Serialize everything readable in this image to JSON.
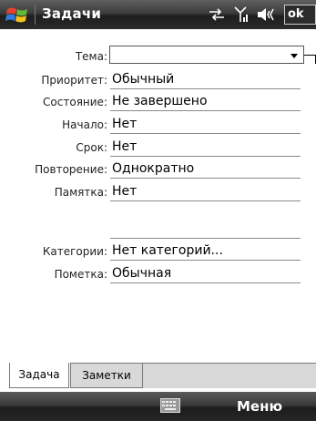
{
  "titlebar": {
    "title": "Задачи",
    "ok_label": "ok"
  },
  "form": {
    "subject_label": "Тема:",
    "subject_value": "",
    "fields": [
      {
        "label": "Приоритет:",
        "value": "Обычный"
      },
      {
        "label": "Состояние:",
        "value": "Не завершено"
      },
      {
        "label": "Начало:",
        "value": "Нет"
      },
      {
        "label": "Срок:",
        "value": "Нет"
      },
      {
        "label": "Повторение:",
        "value": "Однократно"
      },
      {
        "label": "Памятка:",
        "value": "Нет"
      },
      {
        "label": "Категории:",
        "value": "Нет категорий..."
      },
      {
        "label": "Пометка:",
        "value": "Обычная"
      }
    ]
  },
  "tabs": [
    {
      "label": "Задача",
      "active": true
    },
    {
      "label": "Заметки",
      "active": false
    }
  ],
  "menubar": {
    "menu_label": "Меню"
  },
  "icons": {
    "start": "windows-flag-icon",
    "connectivity": "data-arrows-icon",
    "signal": "signal-antenna-icon",
    "volume": "speaker-icon",
    "keyboard": "keyboard-icon"
  }
}
